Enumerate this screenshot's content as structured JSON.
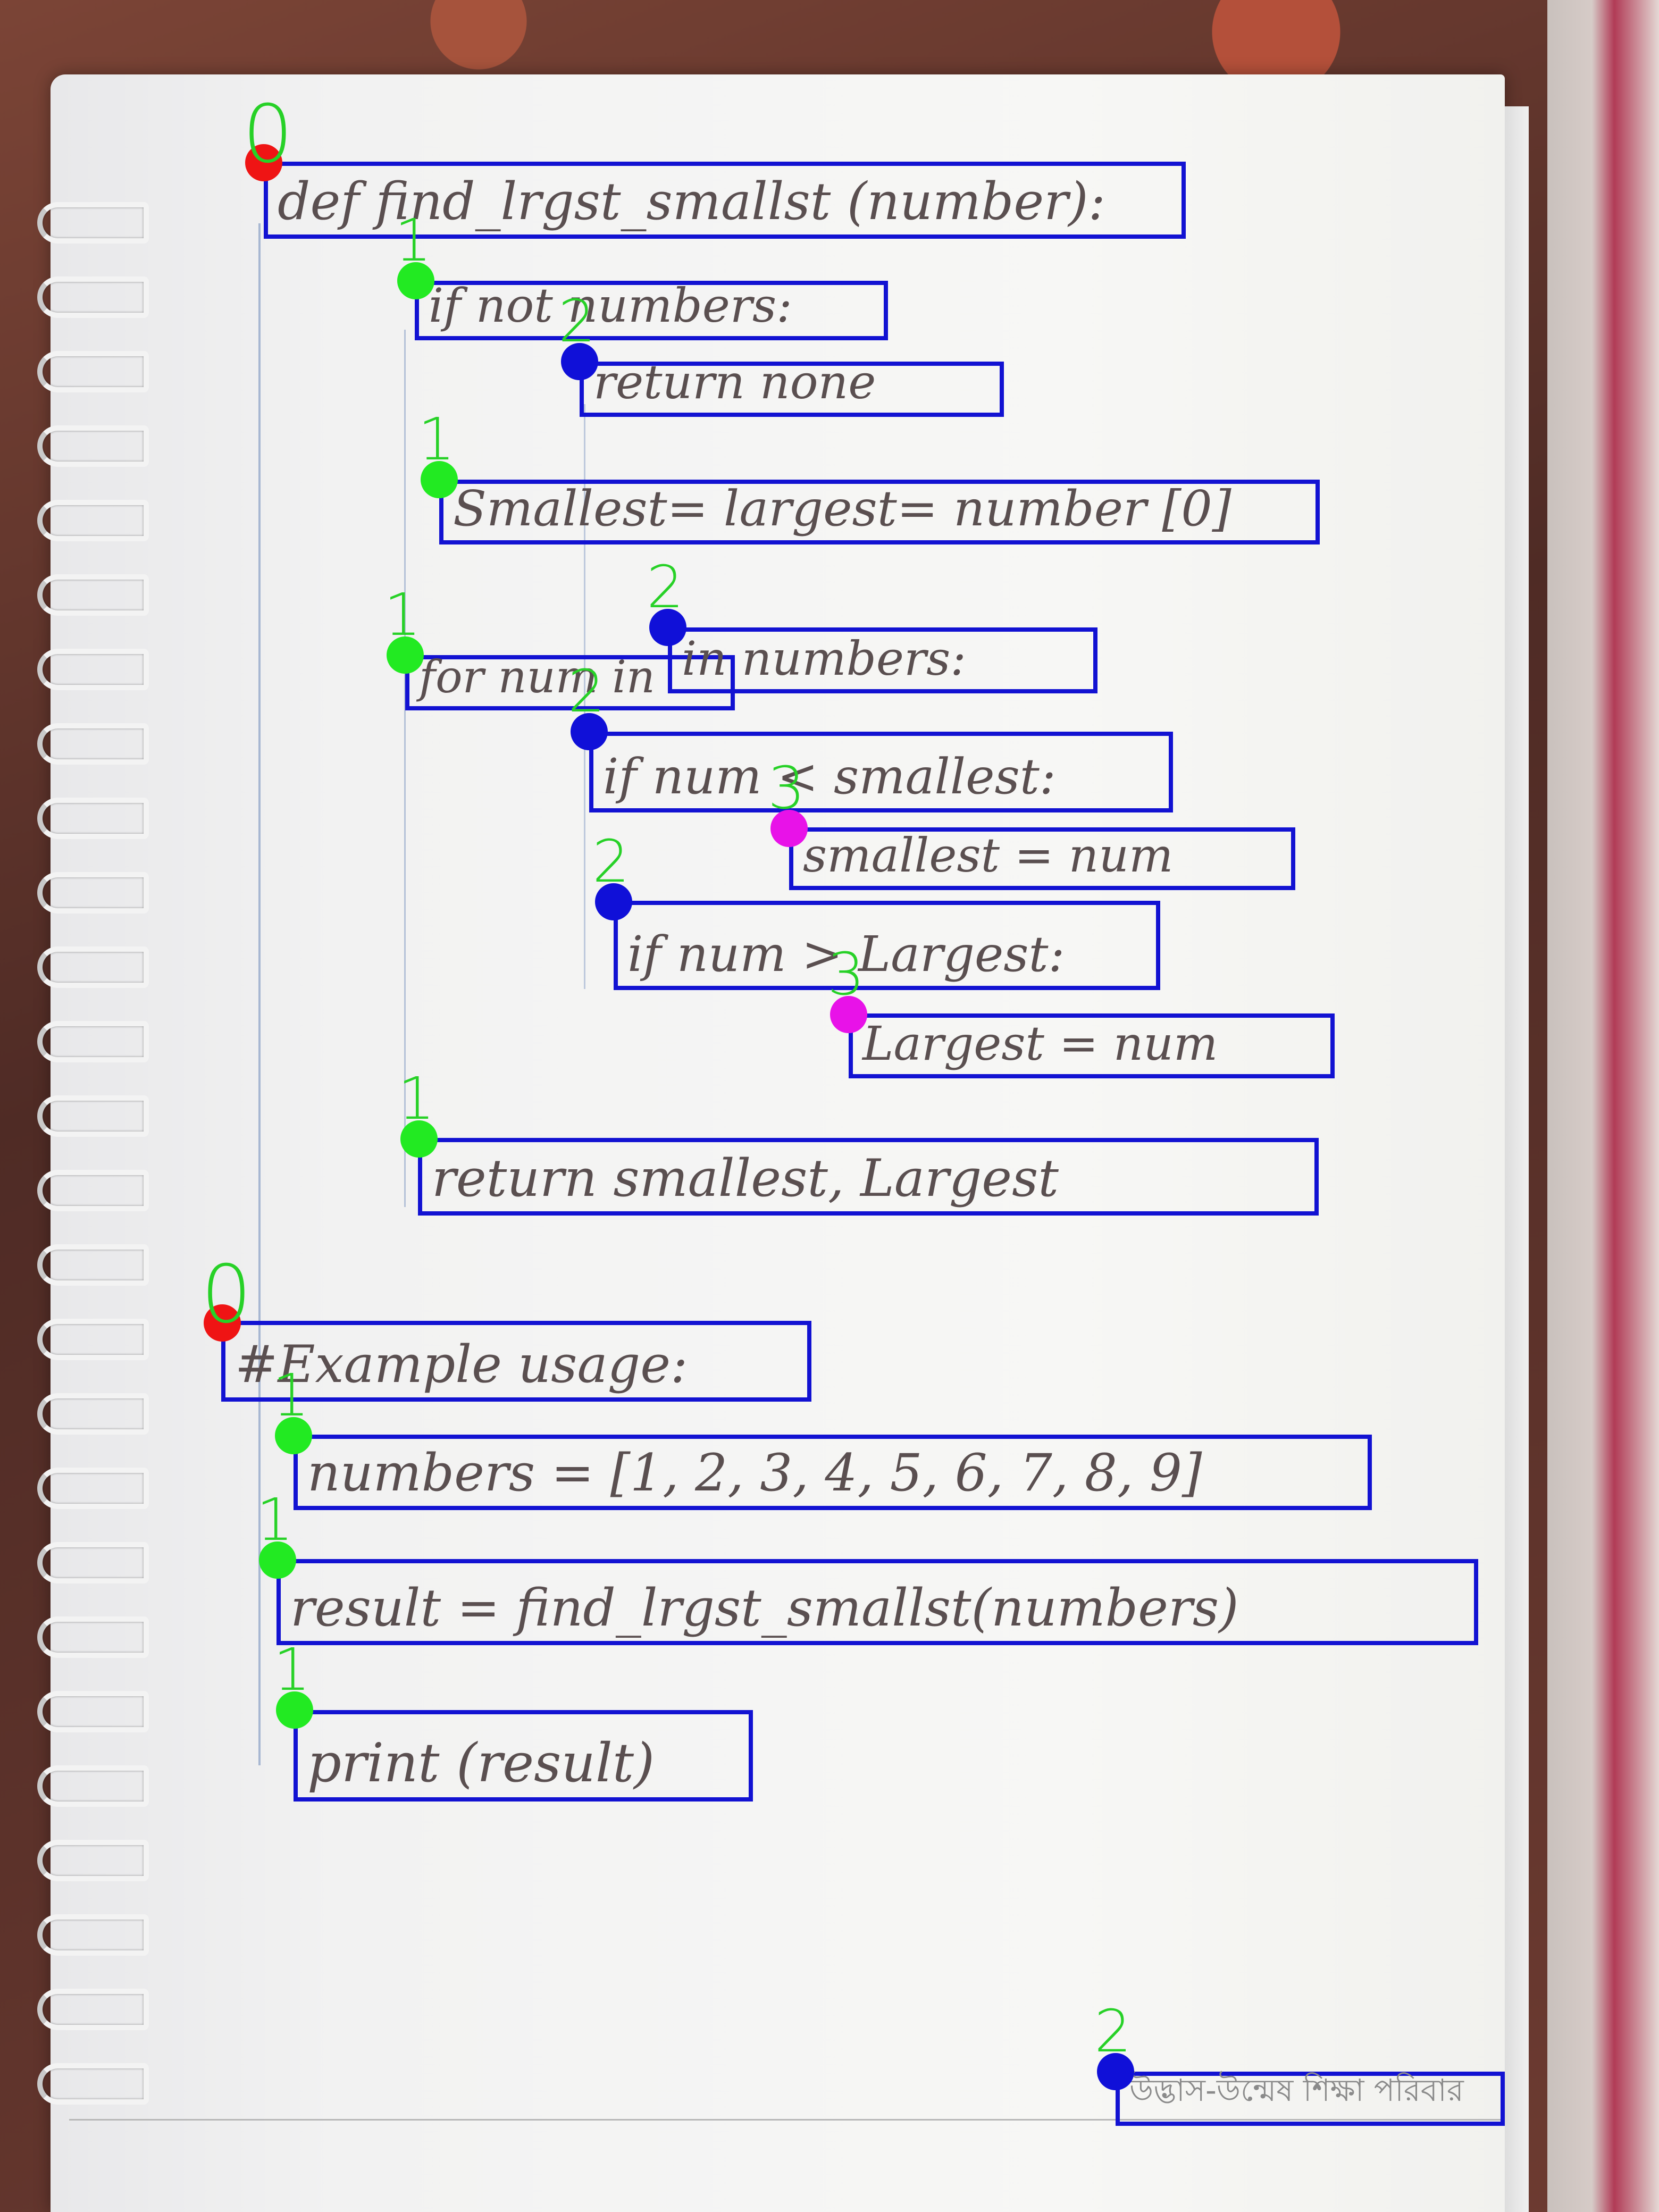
{
  "annotation_colors": {
    "box": "#1212d2",
    "level_label": "#27d127",
    "level_0_dot": "#ef1414",
    "level_1_dot": "#22ea22",
    "level_2_dot": "#1010d8",
    "level_3_dot": "#e812e8"
  },
  "code_lines": [
    {
      "text": "def find_lrgst_smallst (number):",
      "level": "0"
    },
    {
      "text": "if not numbers:",
      "level": "1"
    },
    {
      "text": "return none",
      "level": "2"
    },
    {
      "text": "Smallest= largest= number [0]",
      "level": "1"
    },
    {
      "text": "for num in",
      "level": "1"
    },
    {
      "text": "in numbers:",
      "level": "2"
    },
    {
      "text": "if num < smallest:",
      "level": "2"
    },
    {
      "text": "smallest = num",
      "level": "3"
    },
    {
      "text": "if num > Largest:",
      "level": "2"
    },
    {
      "text": "Largest = num",
      "level": "3"
    },
    {
      "text": "return smallest, Largest",
      "level": "1"
    },
    {
      "text": "#Example usage:",
      "level": "0"
    },
    {
      "text": "numbers = [1, 2, 3, 4, 5, 6, 7, 8, 9]",
      "level": "1"
    },
    {
      "text": "result = find_lrgst_smallst(numbers)",
      "level": "1"
    },
    {
      "text": "print (result)",
      "level": "1"
    },
    {
      "text": "উদ্ভাস-উন্মেষ শিক্ষা পরিবার",
      "level": "2"
    }
  ]
}
